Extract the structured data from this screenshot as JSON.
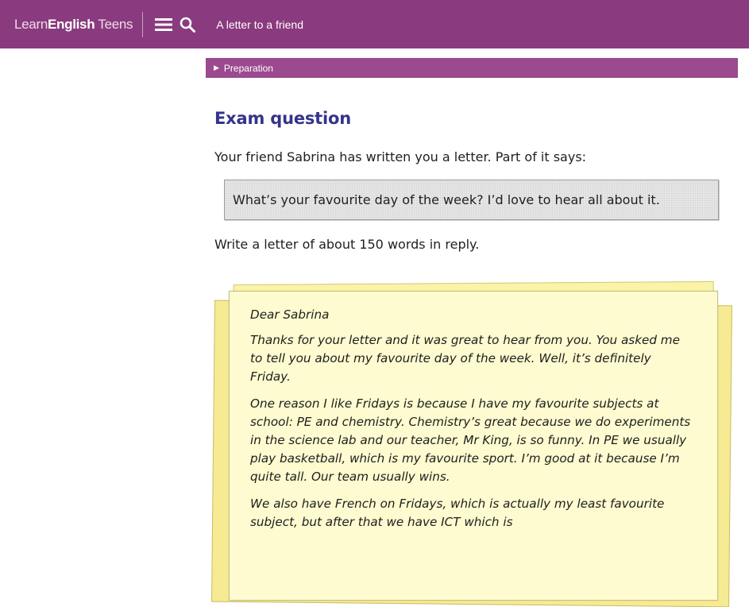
{
  "header": {
    "logo_light": "Learn",
    "logo_bold": "English",
    "logo_light2": " Teens",
    "page_title": "A letter to a friend",
    "menu_icon": "hamburger-icon",
    "search_icon": "search-icon"
  },
  "preparation": {
    "label": "Preparation"
  },
  "exam": {
    "heading": "Exam question",
    "intro": "Your friend Sabrina has written you a letter. Part of it says:",
    "quote": "What’s your favourite day of the week? I’d love to hear all about it.",
    "instruction": "Write a letter of about 150 words in reply."
  },
  "letter": {
    "salutation": "Dear Sabrina",
    "paragraphs": [
      "Thanks for your letter and it was great to hear from you. You asked me to tell you about my favourite day of the week. Well, it’s definitely Friday.",
      "One reason I like Fridays is because I have my favourite subjects at school: PE and chemistry. Chemistry’s great because we do experiments in the science lab and our teacher, Mr King, is so funny. In PE we usually play basketball, which is my favourite sport. I’m good at it because I’m quite tall. Our team usually wins.",
      "We also have French on Fridays, which is actually my least favourite subject, but after that we have ICT which is"
    ]
  },
  "colors": {
    "brand": "#8a3a7e",
    "prep_bar": "#9b4a8f",
    "heading": "#35348a",
    "paper": "#fdfbcf"
  }
}
